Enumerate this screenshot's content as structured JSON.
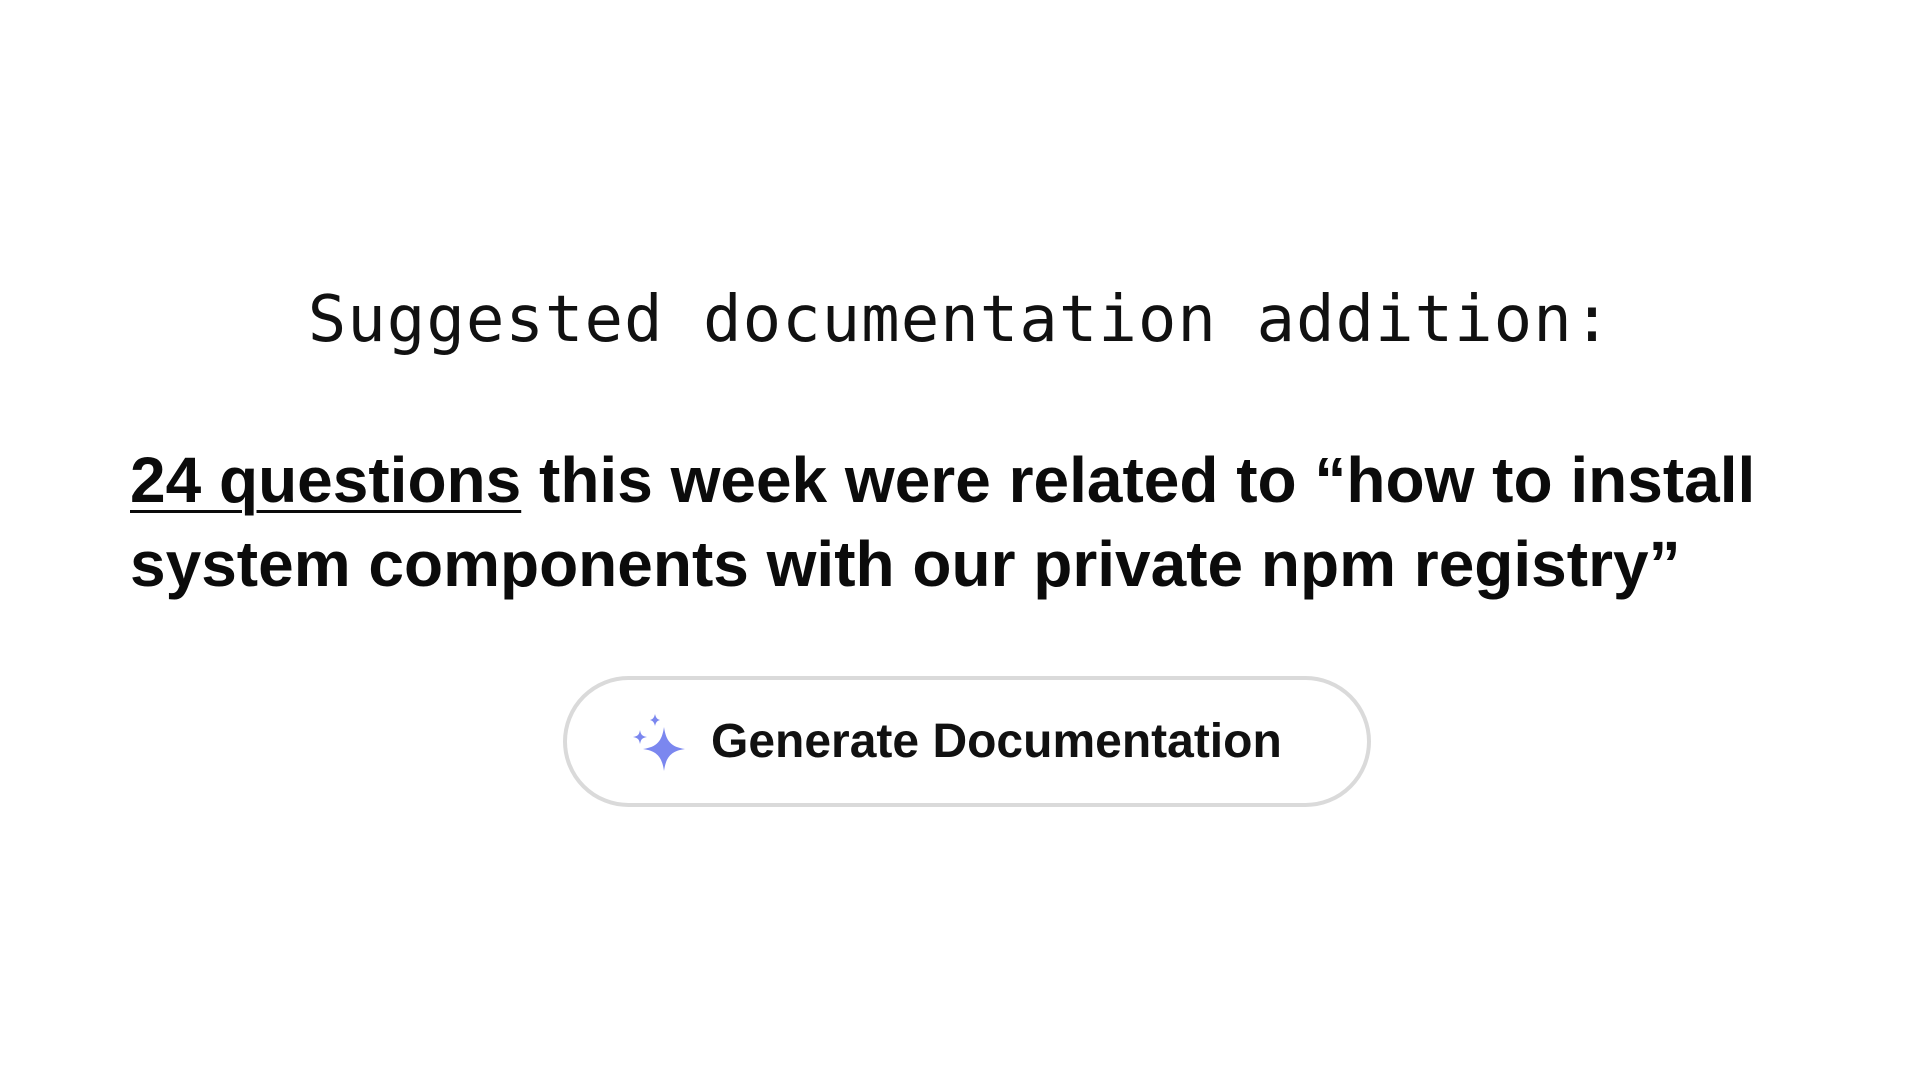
{
  "heading": "Suggested documentation addition:",
  "message": {
    "count_link": "24 questions",
    "line1_rest": " this week were related to “how to install",
    "line2": "system components with our private npm registry”"
  },
  "button": {
    "label": "Generate Documentation",
    "icon": "sparkle-icon",
    "icon_color": "#7b87ef"
  }
}
